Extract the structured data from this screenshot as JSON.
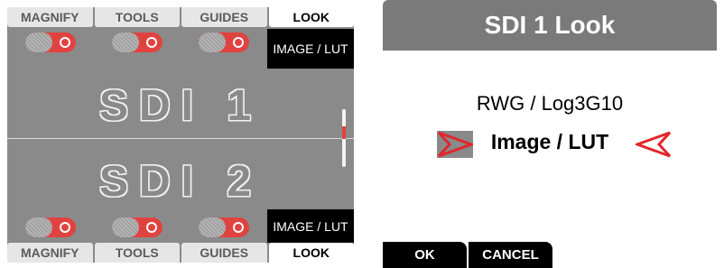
{
  "left_panel": {
    "top_tabs": [
      {
        "label": "MAGNIFY"
      },
      {
        "label": "TOOLS"
      },
      {
        "label": "GUIDES"
      },
      {
        "label": "LOOK",
        "active": true
      }
    ],
    "bottom_tabs": [
      {
        "label": "MAGNIFY"
      },
      {
        "label": "TOOLS"
      },
      {
        "label": "GUIDES"
      },
      {
        "label": "LOOK",
        "active": true
      }
    ],
    "top_image_lut": "IMAGE / LUT",
    "bottom_image_lut": "IMAGE / LUT",
    "sdi1_label": "SDI 1",
    "sdi2_label": "SDI 2",
    "toggle_color": "#e0433f"
  },
  "dialog": {
    "title": "SDI 1 Look",
    "subtitle": "RWG / Log3G10",
    "value": "Image / LUT",
    "ok_label": "OK",
    "cancel_label": "CANCEL",
    "arrow_color": "#e0262b"
  }
}
